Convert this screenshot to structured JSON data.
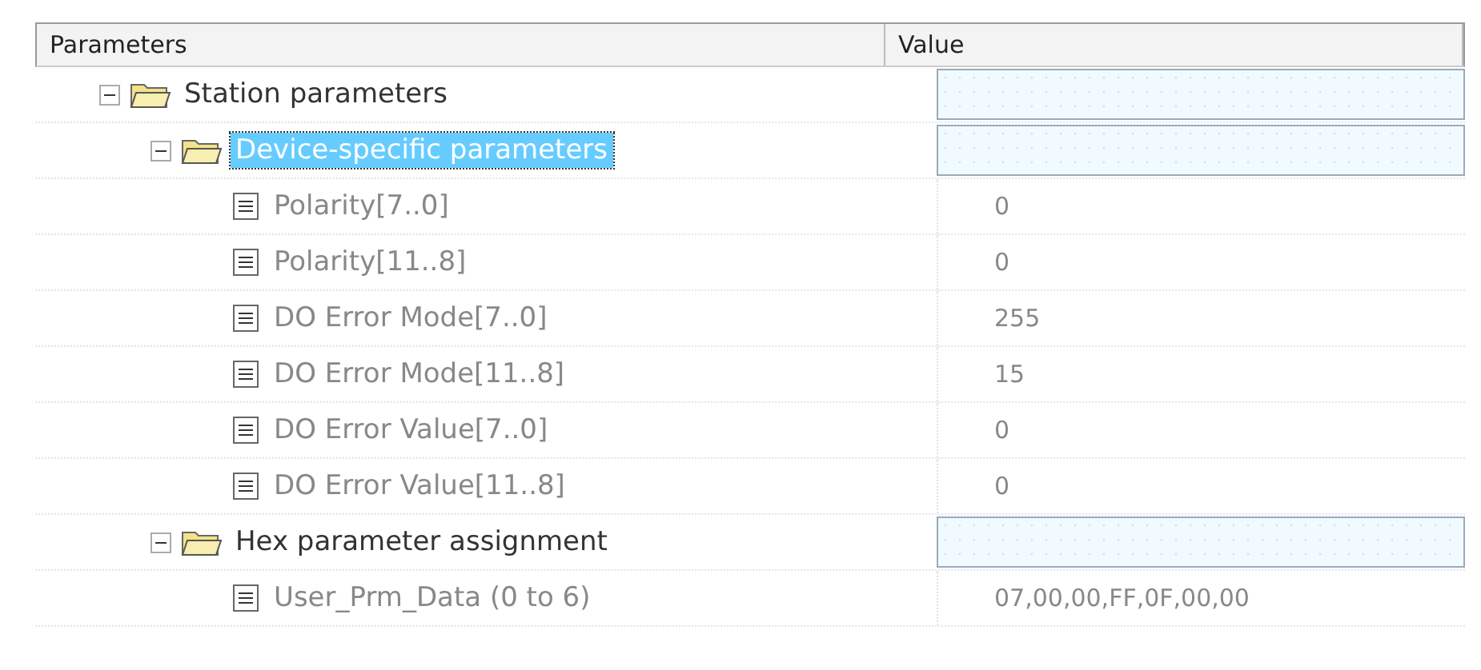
{
  "table": {
    "columns": [
      "Parameters",
      "Value"
    ],
    "tree": [
      {
        "kind": "folder",
        "name": "Station parameters",
        "expanded": true,
        "selected": false,
        "children": [
          {
            "kind": "folder",
            "name": "Device-specific parameters",
            "expanded": true,
            "selected": true,
            "children": [
              {
                "kind": "leaf",
                "name": "Polarity[7..0]",
                "value": "0",
                "selected": false
              },
              {
                "kind": "leaf",
                "name": "Polarity[11..8]",
                "value": "0",
                "selected": false
              },
              {
                "kind": "leaf",
                "name": "DO Error Mode[7..0]",
                "value": "255",
                "selected": false
              },
              {
                "kind": "leaf",
                "name": "DO Error Mode[11..8]",
                "value": "15",
                "selected": false
              },
              {
                "kind": "leaf",
                "name": "DO Error Value[7..0]",
                "value": "0",
                "selected": false
              },
              {
                "kind": "leaf",
                "name": "DO Error Value[11..8]",
                "value": "0",
                "selected": false
              }
            ]
          },
          {
            "kind": "folder",
            "name": "Hex parameter assignment",
            "expanded": true,
            "selected": false,
            "children": [
              {
                "kind": "leaf",
                "name": "User_Prm_Data (0 to 6)",
                "value": "07,00,00,FF,0F,00,00",
                "selected": false
              }
            ]
          }
        ]
      }
    ]
  }
}
